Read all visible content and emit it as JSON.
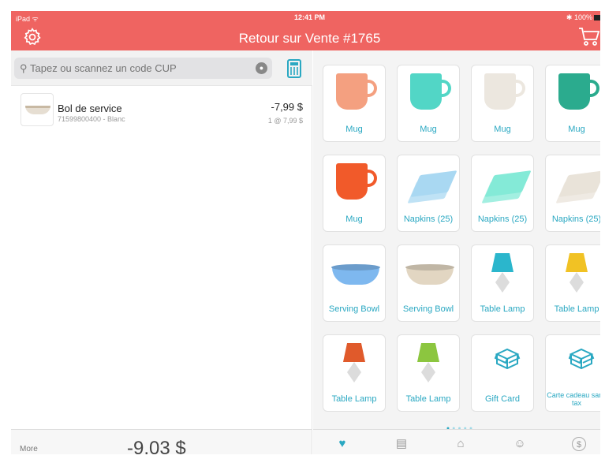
{
  "status": {
    "device": "iPad",
    "time": "12:41 PM",
    "battery": "100%"
  },
  "header": {
    "title": "Retour sur Vente #1765"
  },
  "search": {
    "placeholder": "Tapez ou scannez un code CUP"
  },
  "cart_line": {
    "name": "Bol de service",
    "sub": "71599800400 - Blanc",
    "price": "-7,99 $",
    "unit": "1 @ 7,99 $"
  },
  "footer": {
    "more": "More",
    "total": "-9,03 $"
  },
  "colors": {
    "brand": "#ef6461",
    "accent": "#2aa8c2"
  },
  "products": [
    {
      "label": "Mug",
      "kind": "mug",
      "color": "#f4a080"
    },
    {
      "label": "Mug",
      "kind": "mug",
      "color": "#52d6c6"
    },
    {
      "label": "Mug",
      "kind": "mug",
      "color": "#ece7df"
    },
    {
      "label": "Mug",
      "kind": "mug",
      "color": "#2bab8e"
    },
    {
      "label": "Mug",
      "kind": "mug",
      "color": "#f15a2a"
    },
    {
      "label": "Napkins (25)",
      "kind": "napkin",
      "color": "#a9d8f2"
    },
    {
      "label": "Napkins (25)",
      "kind": "napkin",
      "color": "#84ead7"
    },
    {
      "label": "Napkins (25)",
      "kind": "napkin",
      "color": "#e9e3d9"
    },
    {
      "label": "Serving Bowl",
      "kind": "bowl",
      "color": "#7eb8ef"
    },
    {
      "label": "Serving Bowl",
      "kind": "bowl",
      "color": "#e2d6c2"
    },
    {
      "label": "Table Lamp",
      "kind": "lamp",
      "color": "#2bb6cc"
    },
    {
      "label": "Table Lamp",
      "kind": "lamp",
      "color": "#f1c224"
    },
    {
      "label": "Table Lamp",
      "kind": "lamp",
      "color": "#e05a2b"
    },
    {
      "label": "Table Lamp",
      "kind": "lamp",
      "color": "#8cc63f"
    },
    {
      "label": "Gift Card",
      "kind": "gift",
      "color": "#2aa8c2"
    },
    {
      "label": "Carte cadeau sans tax",
      "kind": "gift",
      "color": "#2aa8c2"
    }
  ],
  "page_dots": 5,
  "page_active": 1,
  "tabs": [
    {
      "label": "Favoris",
      "icon": "heart-icon",
      "active": true
    },
    {
      "label": "Cartes-Cadeaux",
      "icon": "gift-card-icon",
      "active": false
    },
    {
      "label": "Inventaire",
      "icon": "inventory-icon",
      "active": false
    },
    {
      "label": "Clients",
      "icon": "clients-icon",
      "active": false
    },
    {
      "label": "Transactions",
      "icon": "transactions-icon",
      "active": false
    }
  ]
}
